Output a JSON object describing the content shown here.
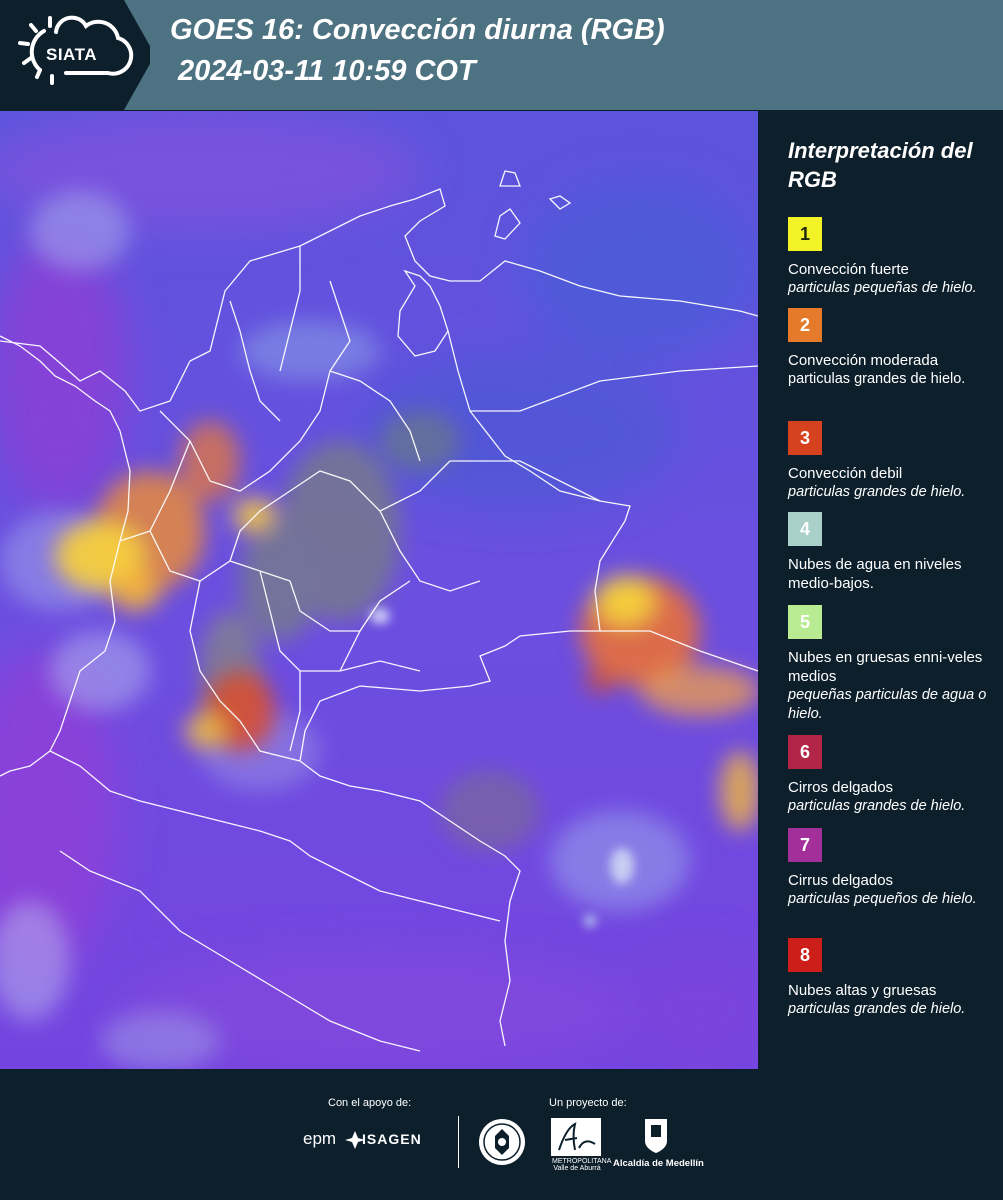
{
  "header": {
    "logo_text": "SIATA",
    "title_line1": "GOES 16: Convección diurna (RGB)",
    "title_line2": "2024-03-11 10:59 COT"
  },
  "legend": {
    "title": "Interpretación del RGB",
    "items": [
      {
        "number": "1",
        "color": "#f2f227",
        "text_color": "#1e2a10",
        "label": "Convección fuerte",
        "sub": "particulas pequeñas de hielo."
      },
      {
        "number": "2",
        "color": "#e57a2a",
        "text_color": "#ffffff",
        "label": "Convección moderada",
        "sub": "particulas grandes de hielo.",
        "sub_style": "normal"
      },
      {
        "number": "3",
        "color": "#d6421e",
        "text_color": "#ffffff",
        "label": "Convección debil",
        "sub": "particulas grandes de hielo."
      },
      {
        "number": "4",
        "color": "#a9cfc9",
        "text_color": "#ffffff",
        "label": "Nubes de agua en niveles medio-bajos.",
        "sub": ""
      },
      {
        "number": "5",
        "color": "#b9eb92",
        "text_color": "#ffffff",
        "label": "Nubes en gruesas enni-veles medios",
        "sub": "pequeñas particulas de agua o hielo."
      },
      {
        "number": "6",
        "color": "#b32547",
        "text_color": "#ffffff",
        "label": "Cirros delgados",
        "sub": "particulas grandes de hielo."
      },
      {
        "number": "7",
        "color": "#a32f9a",
        "text_color": "#ffffff",
        "label": "Cirrus delgados",
        "sub": "particulas pequeños de hielo."
      },
      {
        "number": "8",
        "color": "#cc1f1a",
        "text_color": "#ffffff",
        "label": "Nubes altas y gruesas",
        "sub": "particulas grandes de hielo."
      }
    ]
  },
  "footer": {
    "support_label": "Con el apoyo de:",
    "project_label": "Un proyecto de:",
    "epm": "epm",
    "isagen": "ISAGEN",
    "area_text": "METROPOLITANA Valle de Aburrá",
    "alcaldia": "Alcaldía de Medellín"
  },
  "colors": {
    "header_bg": "#4d7281",
    "panel_bg": "#0c1f2b",
    "map_base": "#6a4fe0"
  },
  "icons": [
    "sun-cloud-logo-icon",
    "epm-logo-icon",
    "isagen-logo-icon",
    "seal-logo-icon",
    "area-metropolitana-logo-icon",
    "alcaldia-shield-icon"
  ]
}
